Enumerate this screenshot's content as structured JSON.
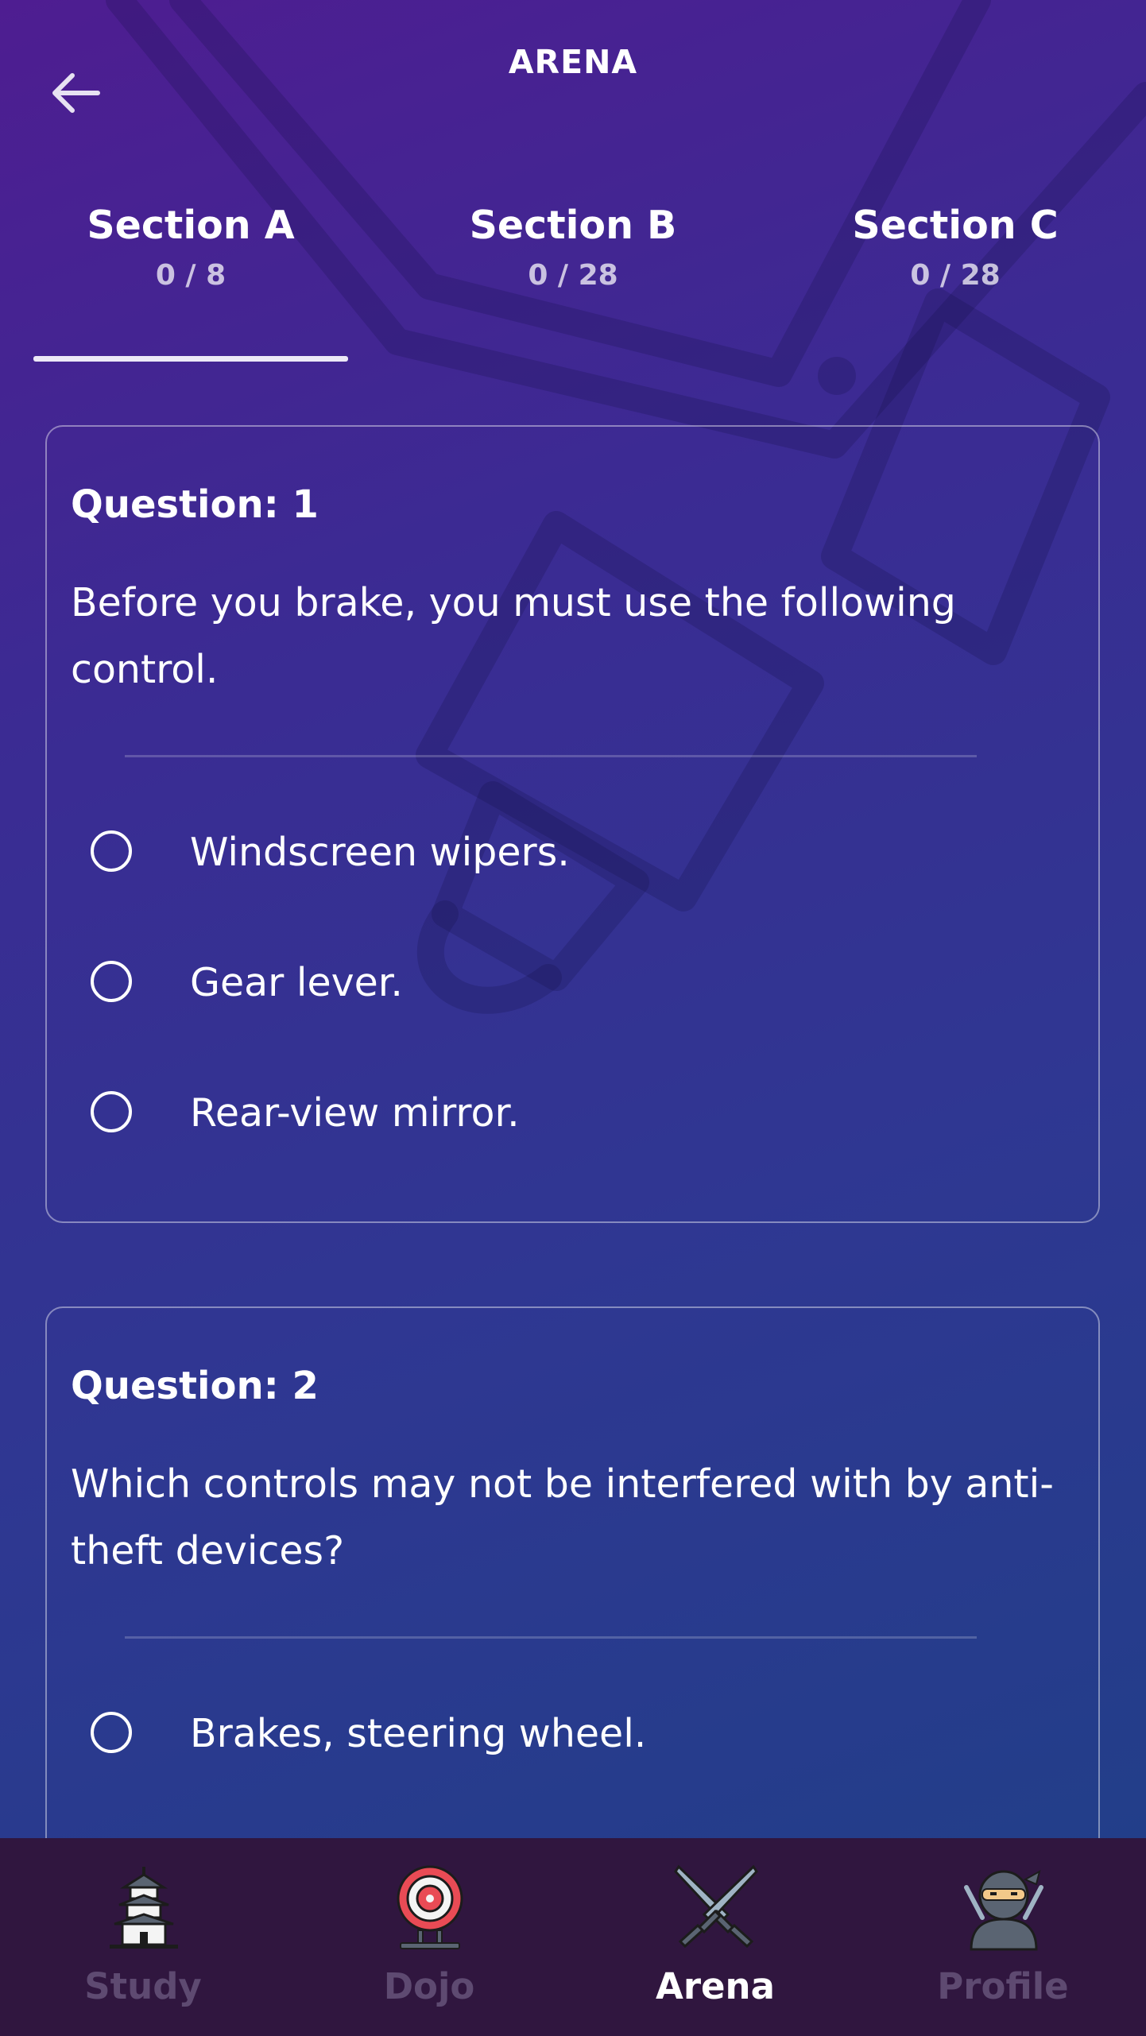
{
  "header": {
    "title": "ARENA"
  },
  "tabs": [
    {
      "title": "Section A",
      "count": "0 / 8",
      "active": true
    },
    {
      "title": "Section B",
      "count": "0 / 28",
      "active": false
    },
    {
      "title": "Section C",
      "count": "0 / 28",
      "active": false
    }
  ],
  "questions": [
    {
      "label": "Question: 1",
      "text": "Before you brake, you must use the following control.",
      "options": [
        "Windscreen wipers.",
        "Gear lever.",
        "Rear-view mirror."
      ]
    },
    {
      "label": "Question: 2",
      "text": "Which controls may not be interfered with by anti-theft devices?",
      "options": [
        "Brakes, steering wheel."
      ]
    }
  ],
  "bottom_nav": [
    {
      "label": "Study",
      "icon": "pagoda-icon",
      "active": false
    },
    {
      "label": "Dojo",
      "icon": "target-icon",
      "active": false
    },
    {
      "label": "Arena",
      "icon": "crossed-swords-icon",
      "active": true
    },
    {
      "label": "Profile",
      "icon": "ninja-icon",
      "active": false
    }
  ],
  "colors": {
    "nav_background": "#30163f",
    "nav_inactive_label": "#5e4a71",
    "nav_active_label": "#ffffff",
    "bg_gradient_start": "#4e1d91",
    "bg_gradient_end": "#1f4087"
  }
}
